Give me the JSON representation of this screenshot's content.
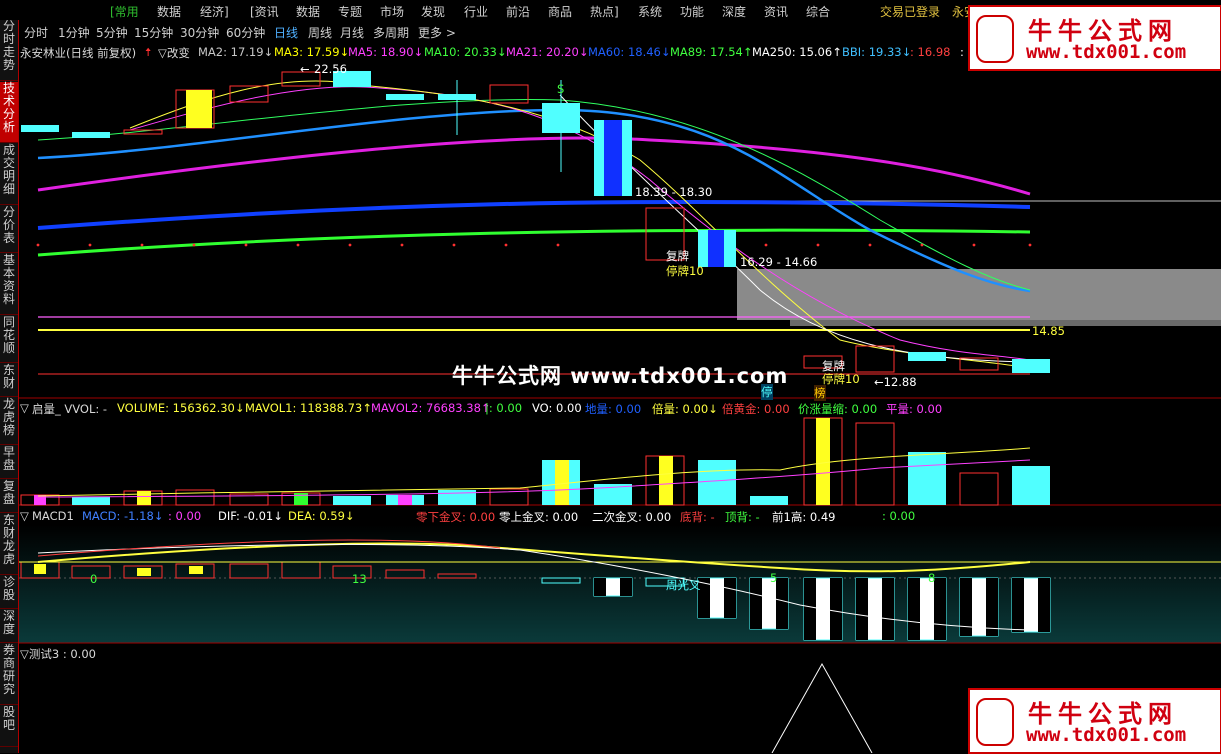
{
  "menubar": {
    "items": [
      "[常用",
      "数据",
      "经济]",
      "[资讯",
      "数据",
      "专题",
      "市场",
      "发现",
      "行业",
      "前沿",
      "商品",
      "热点]",
      "系统",
      "功能",
      "深度",
      "资讯",
      "综合"
    ],
    "status": "交易已登录",
    "status_extra": "永安"
  },
  "tabs": [
    "分时",
    "1分钟",
    "5分钟",
    "15分钟",
    "30分钟",
    "60分钟",
    "日线",
    "周线",
    "月线",
    "多周期",
    "更多 >"
  ],
  "sidebar": [
    "分时走势",
    "技术分析",
    "成交明细",
    "分价表",
    "基本资料",
    "同花顺",
    "东财",
    "龙虎榜",
    "早盘",
    "复盘",
    "东财龙虎",
    "诊股",
    "深度",
    "券商研究",
    "股吧"
  ],
  "main_legend": {
    "title": "永安林业(日线 前复权)",
    "flag": "▽改变",
    "items": [
      {
        "t": "MA2: 17.19↓",
        "c": "#ffffff"
      },
      {
        "t": "MA3: 17.59↓",
        "c": "#ffff00"
      },
      {
        "t": "MA5: 18.90↓",
        "c": "#ff40ff"
      },
      {
        "t": "MA10: 20.33↓",
        "c": "#40ff40"
      },
      {
        "t": "MA21: 20.20↓",
        "c": "#ff40ff"
      },
      {
        "t": "MA60: 18.46↓",
        "c": "#2060ff"
      },
      {
        "t": "MA89: 17.54↑",
        "c": "#40ff40"
      },
      {
        "t": "MA250: 15.06↑",
        "c": "#ffffff"
      },
      {
        "t": "BBI: 19.33↓",
        "c": "#40c0ff"
      },
      {
        "t": ": 16.98",
        "c": "#ff4040"
      },
      {
        "t": ": 1",
        "c": "#ffffff"
      }
    ]
  },
  "price_labels": {
    "high": "22.56",
    "range1": "18.39 - 18.30",
    "range2": "16.29 - 14.66",
    "low": "←12.88",
    "right_price": "14.85",
    "resume1": "复牌",
    "halt1": "停牌10",
    "resume2": "复牌",
    "halt2": "停牌10",
    "mark_s": "S",
    "mark_ting": "停",
    "mark_bang": "榜"
  },
  "volume_legend": {
    "title": "启量_ VVOL: -",
    "items": [
      {
        "t": "VOLUME: 156362.30↓",
        "c": "#ffff40"
      },
      {
        "t": "MAVOL1: 118388.73↑",
        "c": "#ffff40"
      },
      {
        "t": "MAVOL2: 76683.38↑",
        "c": "#ff40ff"
      },
      {
        "t": "|: 0.00",
        "c": "#40ff40"
      },
      {
        "t": "VO: 0.00",
        "c": "#ffffff"
      },
      {
        "t": "地量: 0.00",
        "c": "#2060ff"
      },
      {
        "t": "倍量: 0.00↓",
        "c": "#ffff40"
      },
      {
        "t": "倍黄金: 0.00",
        "c": "#ff4040"
      },
      {
        "t": "价涨量缩: 0.00",
        "c": "#40ff40"
      },
      {
        "t": "平量: 0.00",
        "c": "#ff40ff"
      }
    ]
  },
  "macd_legend": {
    "title": "MACD1",
    "items": [
      {
        "t": "MACD: -1.18↓",
        "c": "#4080ff"
      },
      {
        "t": ": 0.00",
        "c": "#ff40ff"
      },
      {
        "t": "DIF: -0.01↓",
        "c": "#ffffff"
      },
      {
        "t": "DEA: 0.59↓",
        "c": "#ffff40"
      },
      {
        "t": "零下金叉: 0.00",
        "c": "#ff4040"
      },
      {
        "t": "零上金叉: 0.00",
        "c": "#ffffff"
      },
      {
        "t": "二次金叉: 0.00",
        "c": "#ffffff"
      },
      {
        "t": "底背: -",
        "c": "#ff4040"
      },
      {
        "t": "顶背: -",
        "c": "#40ff40"
      },
      {
        "t": "前1高: 0.49",
        "c": "#ffffff"
      },
      {
        "t": ": 0.00",
        "c": "#40ff40"
      }
    ],
    "labels": {
      "a": "0",
      "b": "13",
      "c": "周光叉",
      "d": "5",
      "e": "8"
    }
  },
  "test_legend": {
    "title": "▽测试3 : 0.00"
  },
  "watermark": "牛牛公式网 www.tdx001.com",
  "logo": {
    "name": "牛牛公式网",
    "url": "www.tdx001.com"
  }
}
